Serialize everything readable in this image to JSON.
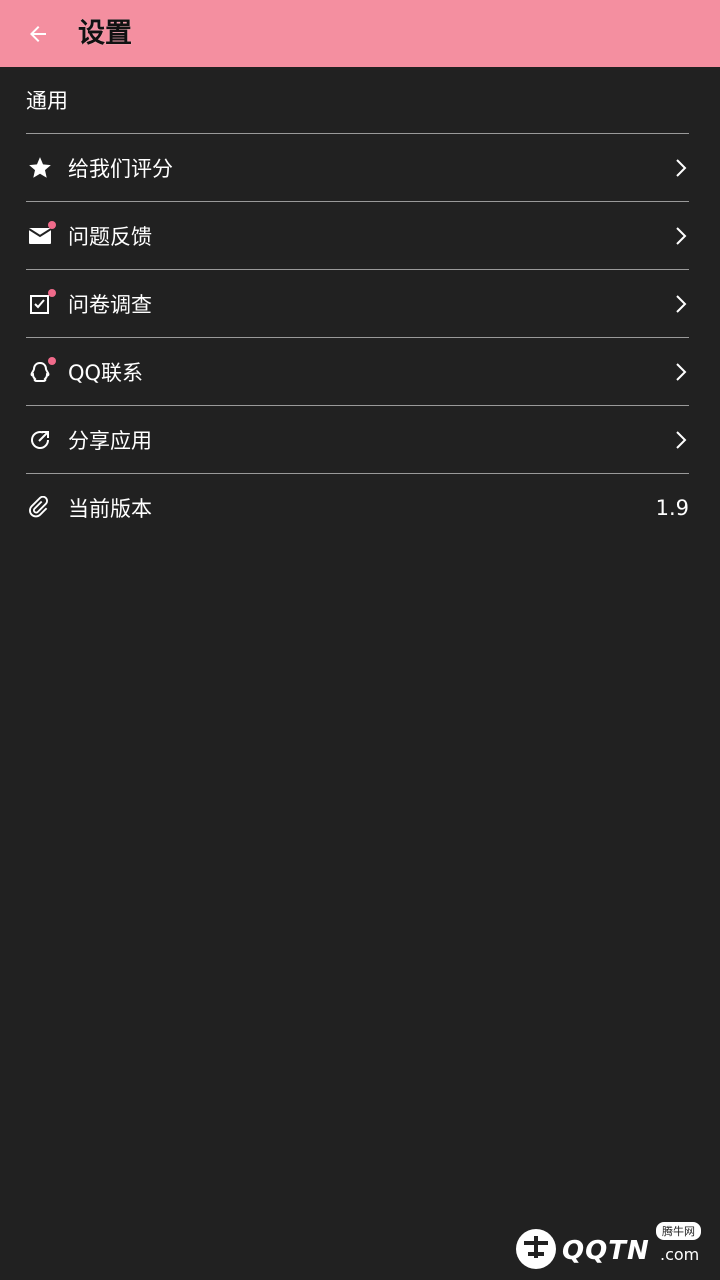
{
  "header": {
    "title": "设置",
    "background": "#f48fa0"
  },
  "section": {
    "title": "通用"
  },
  "items": [
    {
      "label": "给我们评分",
      "icon": "star-icon"
    },
    {
      "label": "问题反馈",
      "icon": "mail-icon"
    },
    {
      "label": "问卷调查",
      "icon": "checkbox-icon"
    },
    {
      "label": "QQ联系",
      "icon": "qq-icon"
    },
    {
      "label": "分享应用",
      "icon": "share-icon"
    },
    {
      "label": "当前版本",
      "icon": "attachment-icon",
      "value": "1.9"
    }
  ],
  "watermark": {
    "brand": "QQTN",
    "domain": ".com",
    "badge": "腾牛网"
  },
  "colors": {
    "background": "#212121",
    "accent_dot": "#f06a8a",
    "divider": "#9a9a9a"
  }
}
